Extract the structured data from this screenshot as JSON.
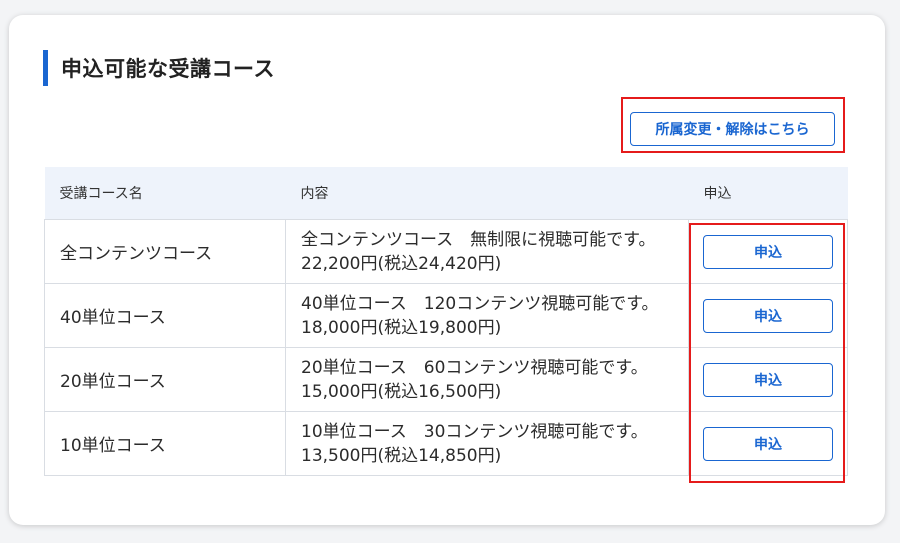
{
  "section": {
    "title": "申込可能な受講コース"
  },
  "transfer_button": {
    "label": "所属変更・解除はこちら"
  },
  "table": {
    "headers": [
      "受講コース名",
      "内容",
      "申込"
    ],
    "rows": [
      {
        "name": "全コンテンツコース",
        "content_line1": "全コンテンツコース　無制限に視聴可能です。",
        "content_line2": "22,200円(税込24,420円)",
        "apply_label": "申込"
      },
      {
        "name": "40単位コース",
        "content_line1": "40単位コース　120コンテンツ視聴可能です。",
        "content_line2": "18,000円(税込19,800円)",
        "apply_label": "申込"
      },
      {
        "name": "20単位コース",
        "content_line1": "20単位コース　60コンテンツ視聴可能です。",
        "content_line2": "15,000円(税込16,500円)",
        "apply_label": "申込"
      },
      {
        "name": "10単位コース",
        "content_line1": "10単位コース　30コンテンツ視聴可能です。",
        "content_line2": "13,500円(税込14,850円)",
        "apply_label": "申込"
      }
    ]
  },
  "colors": {
    "accent": "#1a66d1",
    "highlight": "#e51b1b",
    "header_bg": "#eef3fb"
  }
}
